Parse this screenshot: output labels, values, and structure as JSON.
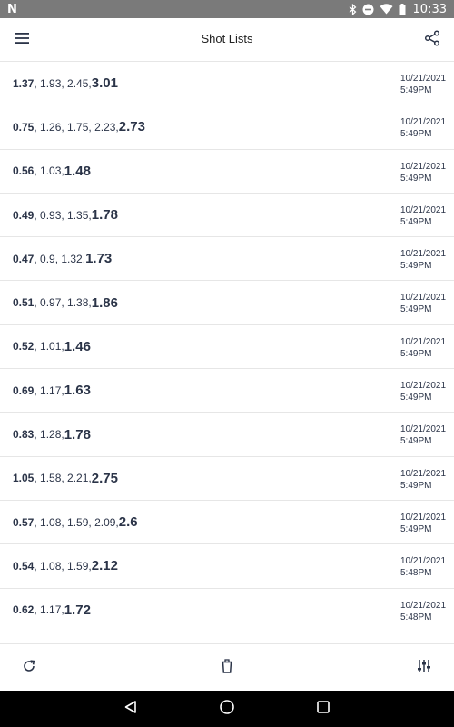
{
  "status_bar": {
    "logo": "N",
    "time": "10:33",
    "icons": [
      "bluetooth-icon",
      "dnd-icon",
      "wifi-icon",
      "battery-icon"
    ]
  },
  "app_bar": {
    "title": "Shot Lists",
    "menu_icon": "hamburger-menu-icon",
    "share_icon": "share-icon"
  },
  "shot_lists": [
    {
      "first": "1.37",
      "middle": ", 1.93, 2.45, ",
      "last": "3.01",
      "date": "10/21/2021",
      "time": "5:49PM"
    },
    {
      "first": "0.75",
      "middle": ", 1.26, 1.75, 2.23, ",
      "last": "2.73",
      "date": "10/21/2021",
      "time": "5:49PM"
    },
    {
      "first": "0.56",
      "middle": ", 1.03, ",
      "last": "1.48",
      "date": "10/21/2021",
      "time": "5:49PM"
    },
    {
      "first": "0.49",
      "middle": ", 0.93, 1.35, ",
      "last": "1.78",
      "date": "10/21/2021",
      "time": "5:49PM"
    },
    {
      "first": "0.47",
      "middle": ", 0.9, 1.32, ",
      "last": "1.73",
      "date": "10/21/2021",
      "time": "5:49PM"
    },
    {
      "first": "0.51",
      "middle": ", 0.97, 1.38, ",
      "last": "1.86",
      "date": "10/21/2021",
      "time": "5:49PM"
    },
    {
      "first": "0.52",
      "middle": ", 1.01, ",
      "last": "1.46",
      "date": "10/21/2021",
      "time": "5:49PM"
    },
    {
      "first": "0.69",
      "middle": ", 1.17, ",
      "last": "1.63",
      "date": "10/21/2021",
      "time": "5:49PM"
    },
    {
      "first": "0.83",
      "middle": ", 1.28, ",
      "last": "1.78",
      "date": "10/21/2021",
      "time": "5:49PM"
    },
    {
      "first": "1.05",
      "middle": ", 1.58, 2.21, ",
      "last": "2.75",
      "date": "10/21/2021",
      "time": "5:49PM"
    },
    {
      "first": "0.57",
      "middle": ", 1.08, 1.59, 2.09, ",
      "last": "2.6",
      "date": "10/21/2021",
      "time": "5:49PM"
    },
    {
      "first": "0.54",
      "middle": ", 1.08, 1.59, ",
      "last": "2.12",
      "date": "10/21/2021",
      "time": "5:48PM"
    },
    {
      "first": "0.62",
      "middle": ", 1.17, ",
      "last": "1.72",
      "date": "10/21/2021",
      "time": "5:48PM"
    }
  ],
  "bottom_bar": {
    "refresh_icon": "refresh-icon",
    "delete_icon": "trash-icon",
    "settings_icon": "tune-sliders-icon"
  },
  "nav_bar": {
    "back_icon": "back-triangle-icon",
    "home_icon": "home-circle-icon",
    "recents_icon": "recents-square-icon"
  },
  "colors": {
    "text": "#2b3448",
    "divider": "#e6e6e6",
    "status_bar": "#7a7a7a",
    "nav_bar": "#000000"
  }
}
